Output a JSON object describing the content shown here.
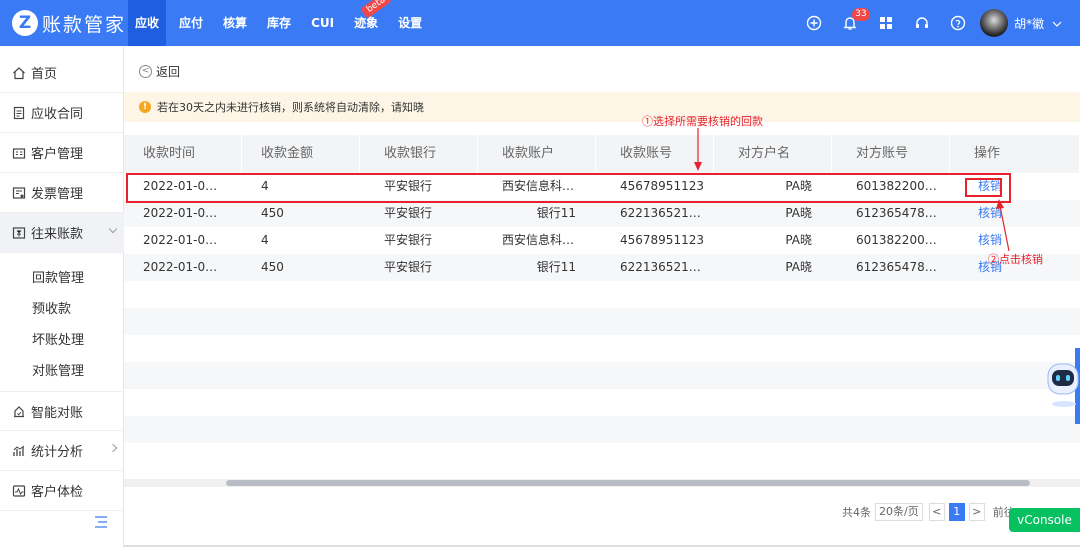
{
  "app": {
    "logo_letter": "Z",
    "logo_text": "账款管家"
  },
  "nav": {
    "items": [
      "应收",
      "应付",
      "核算",
      "库存",
      "CUI",
      "迹象",
      "设置"
    ],
    "active": "应收",
    "beta_label": "beta"
  },
  "topbar": {
    "notification_count": "33",
    "user_name": "胡*徽",
    "icons": [
      "add-circle-icon",
      "bell-icon",
      "apps-grid-icon",
      "headset-icon",
      "help-circle-icon",
      "chevron-down-icon"
    ]
  },
  "sidebar": {
    "items": [
      {
        "label": "首页",
        "icon": "home-icon"
      },
      {
        "label": "应收合同",
        "icon": "document-icon"
      },
      {
        "label": "客户管理",
        "icon": "customer-icon"
      },
      {
        "label": "发票管理",
        "icon": "invoice-icon"
      },
      {
        "label": "往来账款",
        "icon": "account-icon"
      }
    ],
    "sub_items": [
      "回款管理",
      "预收款",
      "坏账处理",
      "对账管理"
    ],
    "bottom_items": [
      {
        "label": "智能对账",
        "icon": "smart-icon"
      },
      {
        "label": "统计分析",
        "icon": "stats-icon"
      },
      {
        "label": "客户体检",
        "icon": "checkup-icon"
      }
    ]
  },
  "page": {
    "back_label": "返回",
    "notice": "若在30天之内未进行核销，则系统将自动清除，请知晓",
    "annotation_1": "①选择所需要核销的回款",
    "annotation_2": "②点击核销"
  },
  "table": {
    "headers": [
      "收款时间",
      "收款金额",
      "收款银行",
      "收款账户",
      "收款账号",
      "对方户名",
      "对方账号",
      "操作"
    ],
    "rows": [
      [
        "2022-01-0…",
        "4",
        "平安银行",
        "西安信息科…",
        "45678951123",
        "PA晓",
        "601382200…",
        "核销"
      ],
      [
        "2022-01-0…",
        "450",
        "平安银行",
        "银行11",
        "622136521…",
        "PA晓",
        "612365478…",
        "核销"
      ],
      [
        "2022-01-0…",
        "4",
        "平安银行",
        "西安信息科…",
        "45678951123",
        "PA晓",
        "601382200…",
        "核销"
      ],
      [
        "2022-01-0…",
        "450",
        "平安银行",
        "银行11",
        "622136521…",
        "PA晓",
        "612365478…",
        "核销"
      ]
    ]
  },
  "pagination": {
    "total": "共4条",
    "page_size": "20条/页",
    "current": "1",
    "goto_label": "前往"
  },
  "vconsole_label": "vConsole",
  "colors": {
    "primary": "#3a7bf5",
    "annotation": "#e8222c",
    "notice_bg": "#fdf6e6"
  }
}
